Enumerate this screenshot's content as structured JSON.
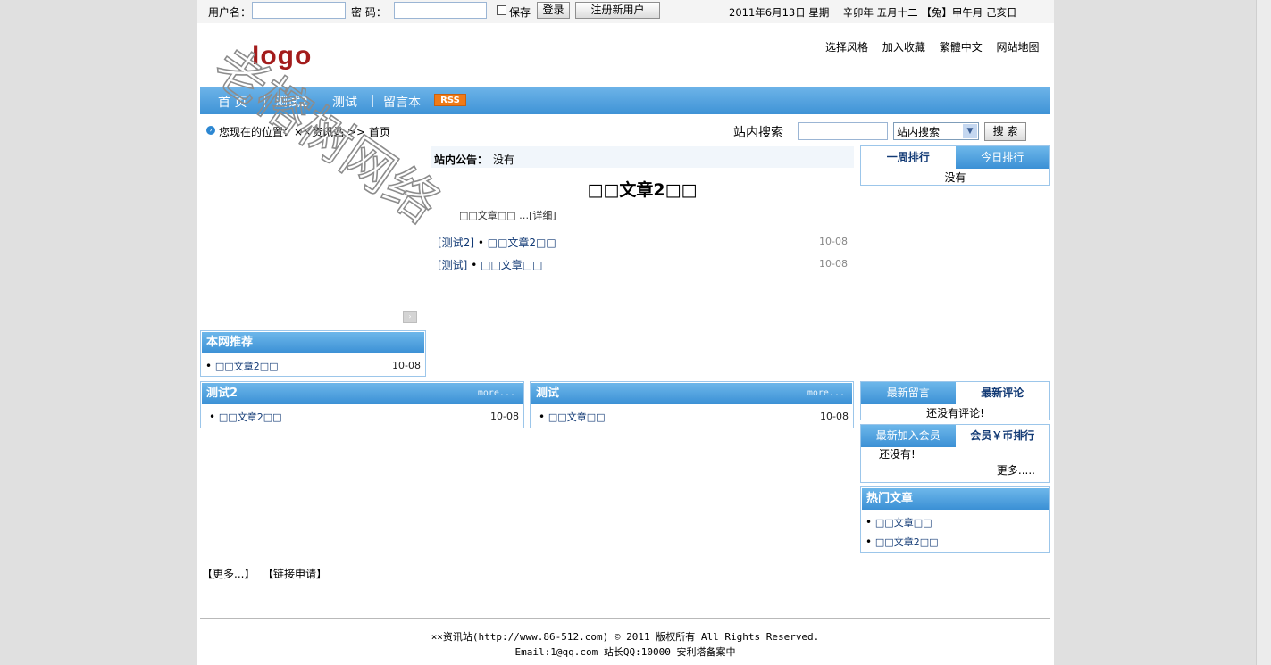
{
  "topbar": {
    "username_label": "用户名：",
    "password_label": "密  码：",
    "save_label": "保存",
    "login_button": "登录",
    "register_button": "注册新用户",
    "date_text": "2011年6月13日 星期一  辛卯年 五月十二 【兔】甲午月 己亥日"
  },
  "header": {
    "logo_text": "logo",
    "links": [
      "选择风格",
      "加入收藏",
      "繁體中文",
      "网站地图"
    ]
  },
  "nav": {
    "items": [
      "首 页",
      "测试2",
      "测试",
      "留言本"
    ],
    "rss_label": "RSS"
  },
  "breadcrumb": {
    "text": "您现在的位置：××资讯站 >> 首页"
  },
  "search": {
    "label": "站内搜索",
    "select_value": "站内搜索",
    "button": "搜 索"
  },
  "notice": {
    "label": "站内公告：",
    "text": "没有"
  },
  "headline": {
    "title": "□□文章2□□",
    "summary": "□□文章□□ …[详细]"
  },
  "top_articles": [
    {
      "category": "[测试2]",
      "title": "□□文章2□□",
      "date": "10-08"
    },
    {
      "category": "[测试]",
      "title": "□□文章□□",
      "date": "10-08"
    }
  ],
  "ranking": {
    "tabs": [
      "一周排行",
      "今日排行"
    ],
    "empty_text": "没有"
  },
  "recommend": {
    "title": "本网推荐",
    "items": [
      {
        "title": "□□文章2□□",
        "date": "10-08"
      }
    ]
  },
  "category_boxes": [
    {
      "title": "测试2",
      "more": "more...",
      "items": [
        {
          "title": "□□文章2□□",
          "date": "10-08"
        }
      ]
    },
    {
      "title": "测试",
      "more": "more...",
      "items": [
        {
          "title": "□□文章□□",
          "date": "10-08"
        }
      ]
    }
  ],
  "comments": {
    "tabs": [
      "最新留言",
      "最新评论"
    ],
    "empty_text": "还没有评论!"
  },
  "members": {
    "tabs": [
      "最新加入会员",
      "会员￥币排行"
    ],
    "empty_text": "还没有!",
    "more": "更多....."
  },
  "hot": {
    "title": "热门文章",
    "items": [
      "□□文章□□",
      "□□文章2□□"
    ]
  },
  "links_bar": {
    "more": "【更多...】",
    "apply": "【链接申请】"
  },
  "footer": {
    "line1": "××资讯站(http://www.86-512.com) © 2011 版权所有 All Rights Reserved.",
    "line2": "Email:1@qq.com 站长QQ:10000 安利塔备案中"
  },
  "watermark_text": "老榕树网络",
  "colors": {
    "nav_blue": "#3f93d6",
    "link_blue": "#123a75",
    "rss_orange": "#f07a16",
    "logo_red": "#a31c1c"
  }
}
